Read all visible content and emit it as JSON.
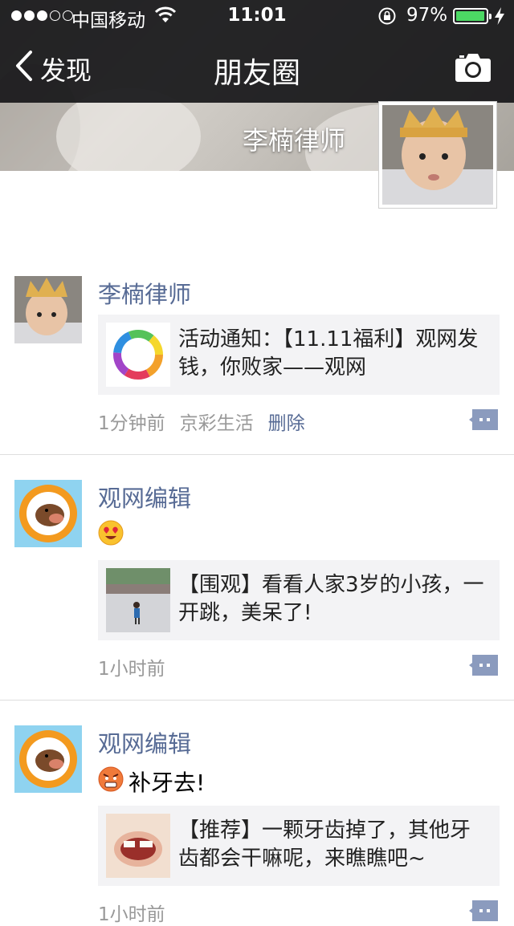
{
  "status_bar": {
    "carrier": "中国移动",
    "time": "11:01",
    "battery_pct": "97%",
    "battery_level": 0.97,
    "signal_bars": 3,
    "icons": [
      "signal-dots-icon",
      "wifi-icon",
      "rotation-lock-icon",
      "battery-icon",
      "charging-bolt-icon"
    ]
  },
  "nav": {
    "back_label": "发现",
    "title": "朋友圈",
    "right_icon": "camera-icon"
  },
  "cover": {
    "user_name": "李楠律师"
  },
  "posts": [
    {
      "name": "李楠律师",
      "share_text": "活动通知：【11.11福利】观网发钱，你败家——观网",
      "time": "1分钟前",
      "source": "京彩生活",
      "delete": "删除"
    },
    {
      "name": "观网编辑",
      "emoji": "heart-eyes-emoji",
      "share_text": "【围观】看看人家3岁的小孩，一开跳，美呆了!",
      "time": "1小时前"
    },
    {
      "name": "观网编辑",
      "emoji": "angry-emoji",
      "text": "补牙去!",
      "share_text": "【推荐】一颗牙齿掉了，其他牙齿都会干嘛呢，来瞧瞧吧~",
      "time": "1小时前"
    }
  ],
  "colors": {
    "link": "#576b95",
    "meta": "#999999",
    "share_bg": "#f3f3f5",
    "nav_bg": "#18181a",
    "battery": "#4cd964"
  }
}
